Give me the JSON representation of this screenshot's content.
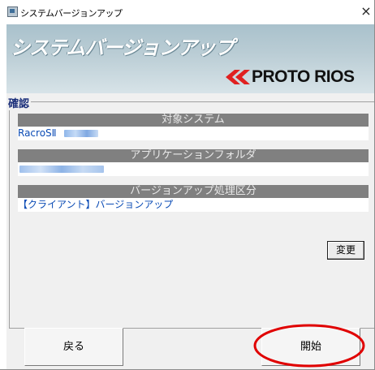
{
  "window": {
    "title": "システムバージョンアップ",
    "close_glyph": "×"
  },
  "banner": {
    "title": "システムバージョンアップ",
    "logo_text": "PROTO RIOS",
    "logo_color": "#e02020"
  },
  "confirm": {
    "legend": "確認",
    "sections": [
      {
        "header": "対象システム",
        "value": "RacroSⅡ"
      },
      {
        "header": "アプリケーションフォルダ",
        "value": ""
      },
      {
        "header": "バージョンアップ処理区分",
        "value": "【クライアント】バージョンアップ"
      }
    ],
    "change_button": "変更"
  },
  "buttons": {
    "back": "戻る",
    "start": "開始"
  },
  "colors": {
    "header_bg": "#808080",
    "value_text": "#0a4bb5",
    "legend_text": "#1b2f7a",
    "highlight": "#e00000"
  }
}
